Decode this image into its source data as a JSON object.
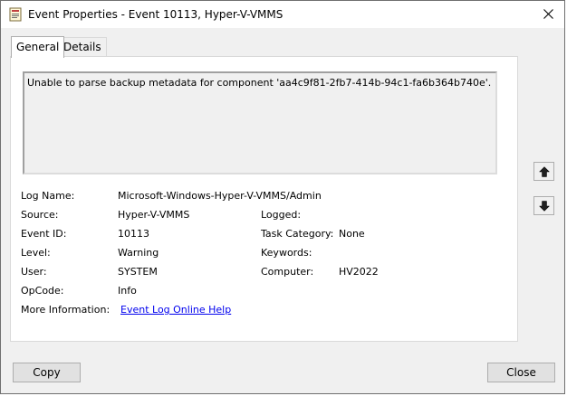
{
  "window": {
    "title": "Event Properties - Event 10113, Hyper-V-VMMS",
    "app_icon": "event-log-icon",
    "close_icon": "close-icon"
  },
  "tabs": [
    {
      "label": "General",
      "selected": true
    },
    {
      "label": "Details",
      "selected": false
    }
  ],
  "description": "Unable to parse backup metadata for component 'aa4c9f81-2fb7-414b-94c1-fa6b364b740e'.",
  "fields": {
    "log_name": {
      "label": "Log Name:",
      "value": "Microsoft-Windows-Hyper-V-VMMS/Admin"
    },
    "source": {
      "label": "Source:",
      "value": "Hyper-V-VMMS"
    },
    "logged": {
      "label": "Logged:",
      "value": ""
    },
    "event_id": {
      "label": "Event ID:",
      "value": "10113"
    },
    "task_category": {
      "label": "Task Category:",
      "value": "None"
    },
    "level": {
      "label": "Level:",
      "value": "Warning"
    },
    "keywords": {
      "label": "Keywords:",
      "value": ""
    },
    "user": {
      "label": "User:",
      "value": "SYSTEM"
    },
    "computer": {
      "label": "Computer:",
      "value": "HV2022"
    },
    "opcode": {
      "label": "OpCode:",
      "value": "Info"
    },
    "more_info": {
      "label": "More Information:",
      "value": "Event Log Online Help"
    }
  },
  "nav": {
    "up_icon": "arrow-up-icon",
    "down_icon": "arrow-down-icon"
  },
  "buttons": {
    "copy": "Copy",
    "close": "Close"
  },
  "colors": {
    "link": "#0000ee",
    "window_bg": "#f0f0f0",
    "panel_bg": "#ffffff"
  }
}
